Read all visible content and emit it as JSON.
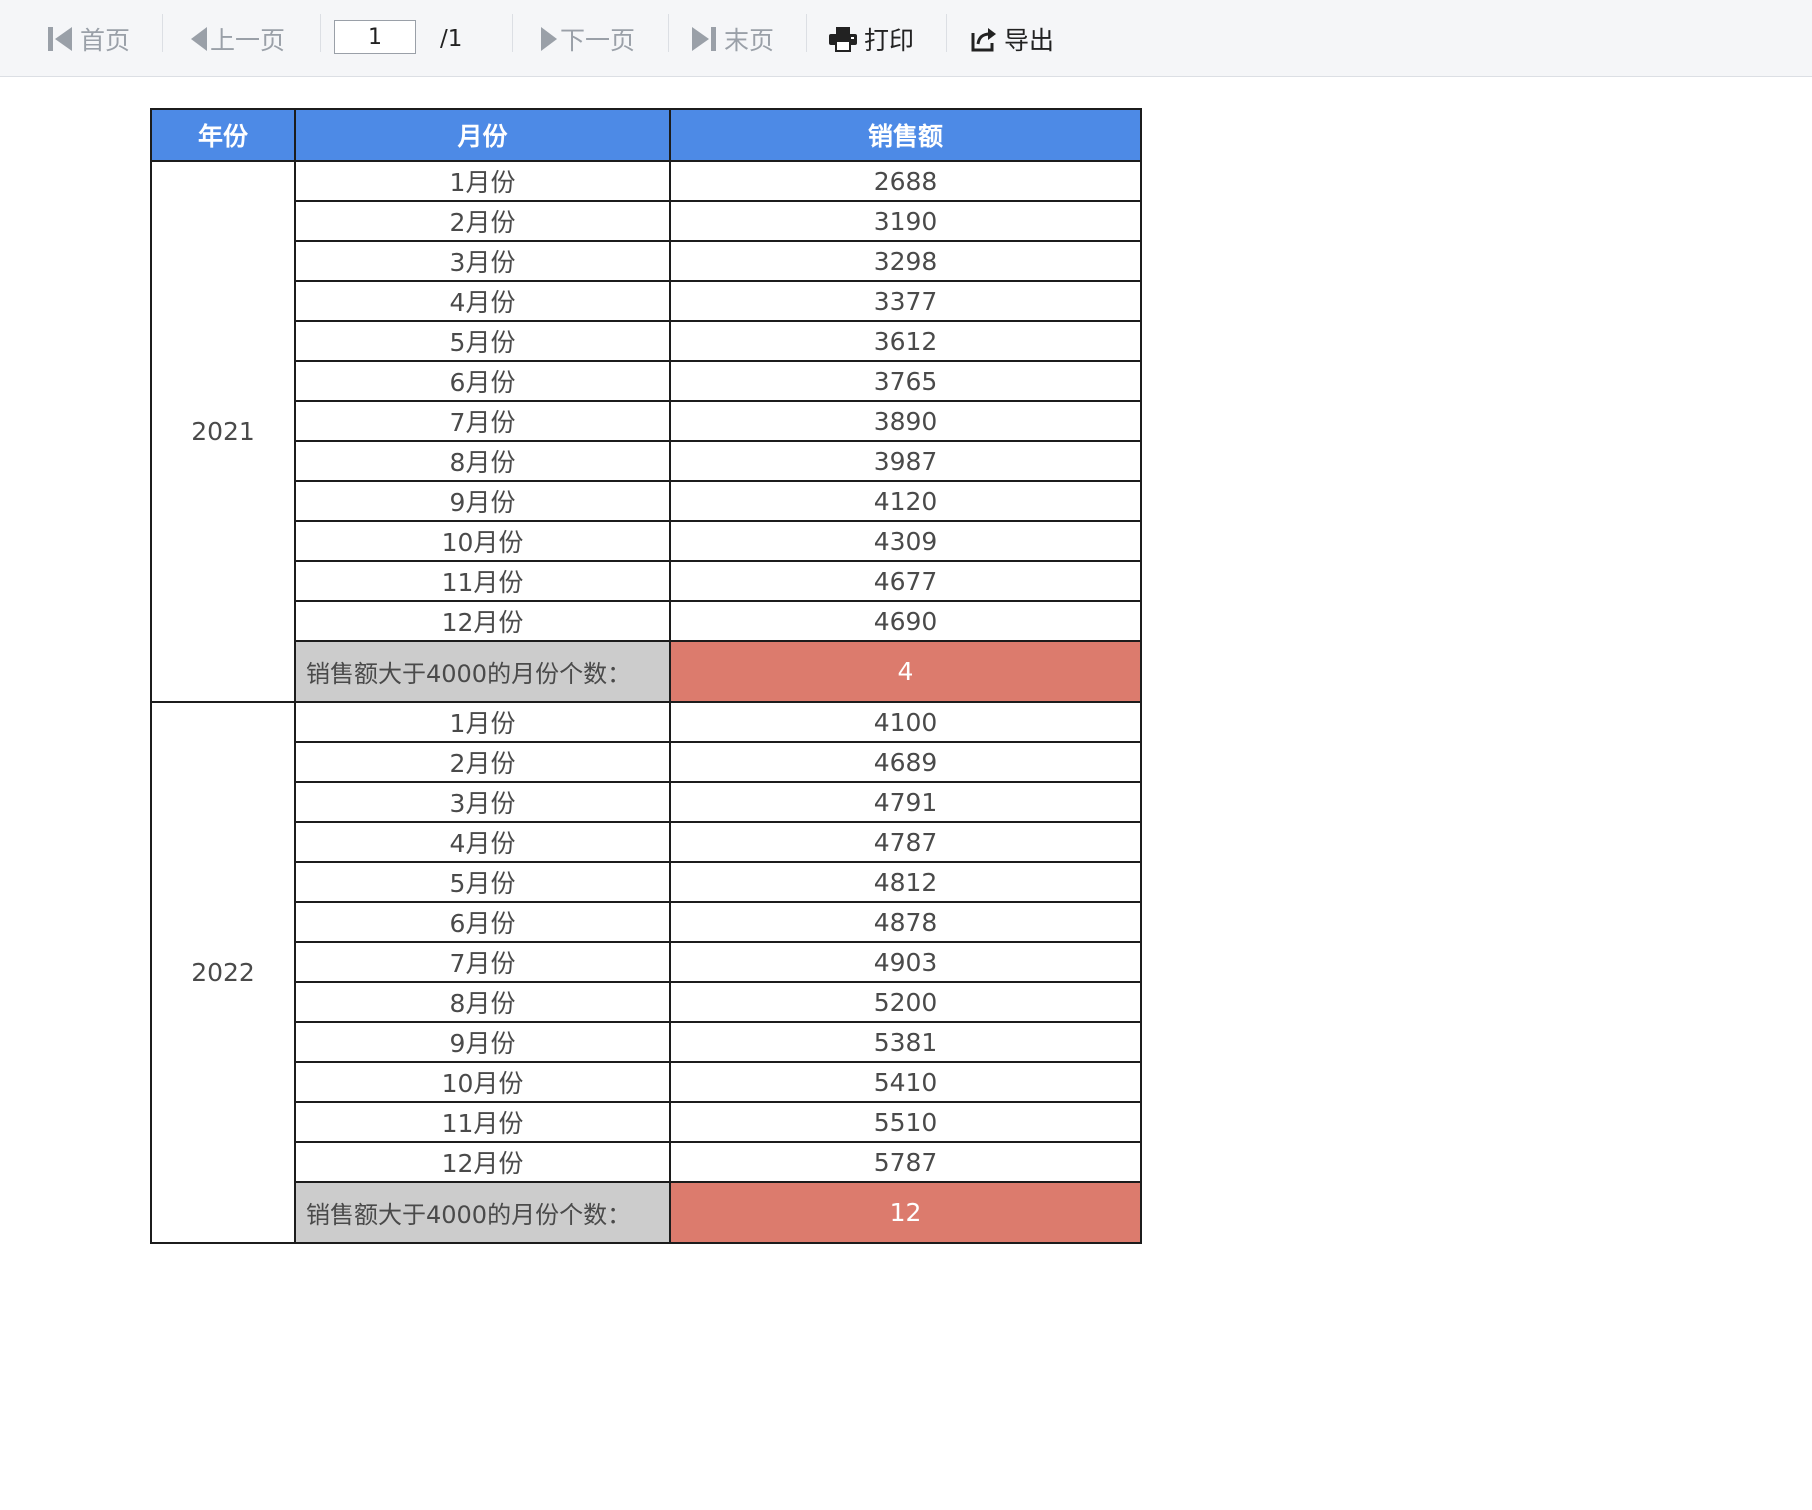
{
  "toolbar": {
    "first_label": "首页",
    "prev_label": "上一页",
    "page_input_value": "1",
    "page_total": "/1",
    "next_label": "下一页",
    "last_label": "末页",
    "print_label": "打印",
    "export_label": "导出",
    "icons": {
      "first": "first-page-icon",
      "prev": "prev-page-icon",
      "next": "next-page-icon",
      "last": "last-page-icon",
      "print": "printer-icon",
      "export": "export-icon"
    }
  },
  "table": {
    "headers": [
      "年份",
      "月份",
      "销售额"
    ],
    "summary_label": "销售额大于4000的月份个数：",
    "colors": {
      "header_bg": "#4d8ae6",
      "summary_label_bg": "#cccccc",
      "summary_value_bg": "#dc7b6d"
    },
    "groups": [
      {
        "year": "2021",
        "rows": [
          {
            "month": "1月份",
            "sales": "2688"
          },
          {
            "month": "2月份",
            "sales": "3190"
          },
          {
            "month": "3月份",
            "sales": "3298"
          },
          {
            "month": "4月份",
            "sales": "3377"
          },
          {
            "month": "5月份",
            "sales": "3612"
          },
          {
            "month": "6月份",
            "sales": "3765"
          },
          {
            "month": "7月份",
            "sales": "3890"
          },
          {
            "month": "8月份",
            "sales": "3987"
          },
          {
            "month": "9月份",
            "sales": "4120"
          },
          {
            "month": "10月份",
            "sales": "4309"
          },
          {
            "month": "11月份",
            "sales": "4677"
          },
          {
            "month": "12月份",
            "sales": "4690"
          }
        ],
        "summary_value": "4"
      },
      {
        "year": "2022",
        "rows": [
          {
            "month": "1月份",
            "sales": "4100"
          },
          {
            "month": "2月份",
            "sales": "4689"
          },
          {
            "month": "3月份",
            "sales": "4791"
          },
          {
            "month": "4月份",
            "sales": "4787"
          },
          {
            "month": "5月份",
            "sales": "4812"
          },
          {
            "month": "6月份",
            "sales": "4878"
          },
          {
            "month": "7月份",
            "sales": "4903"
          },
          {
            "month": "8月份",
            "sales": "5200"
          },
          {
            "month": "9月份",
            "sales": "5381"
          },
          {
            "month": "10月份",
            "sales": "5410"
          },
          {
            "month": "11月份",
            "sales": "5510"
          },
          {
            "month": "12月份",
            "sales": "5787"
          }
        ],
        "summary_value": "12"
      }
    ]
  }
}
